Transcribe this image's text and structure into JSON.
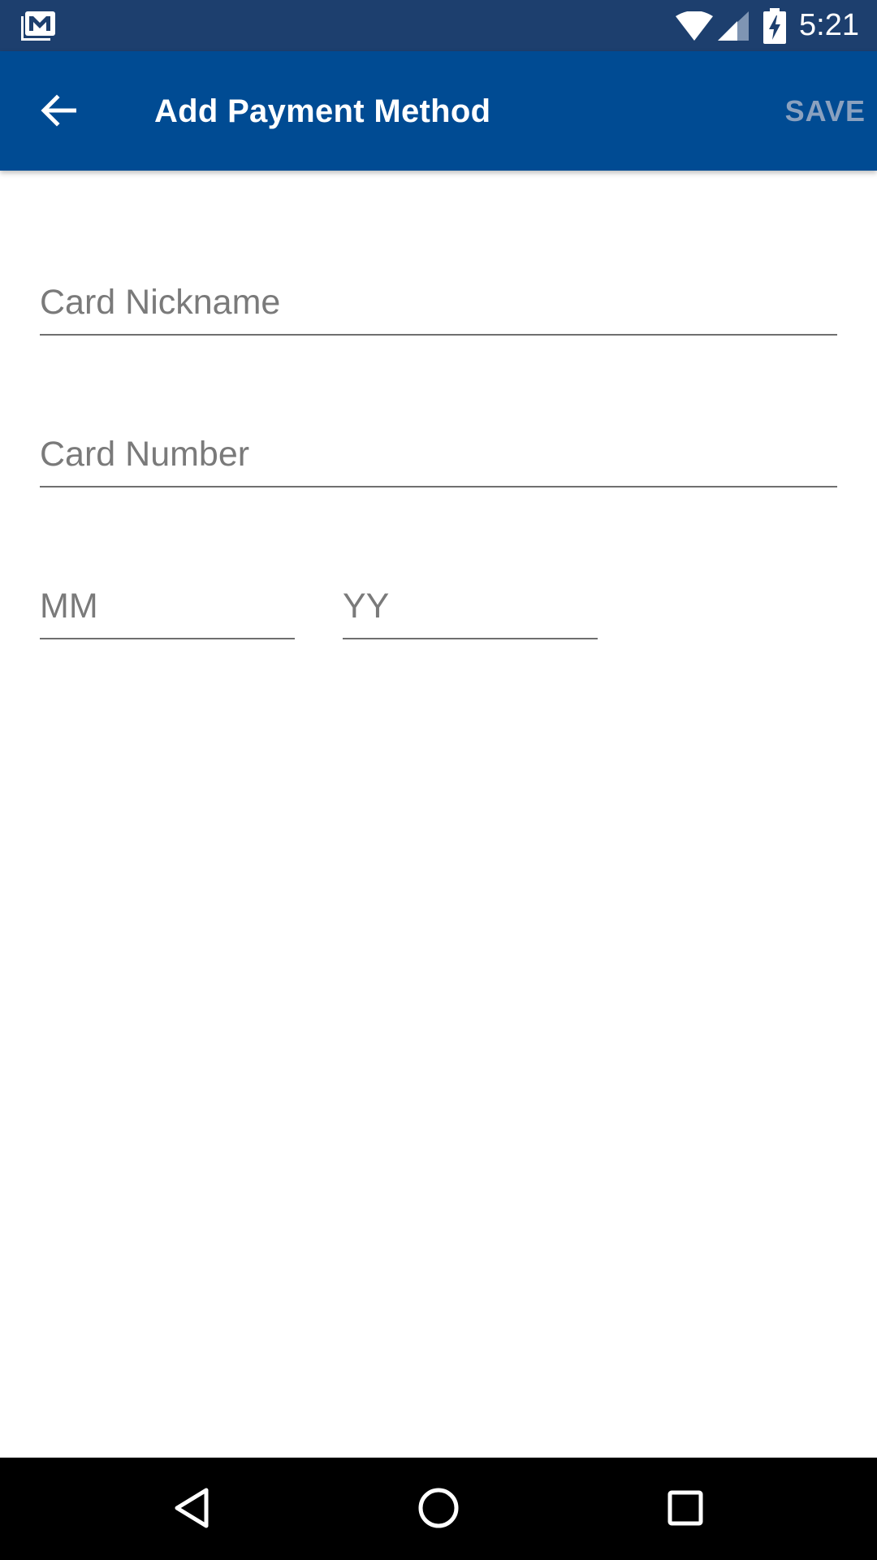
{
  "status_bar": {
    "time": "5:21",
    "icons": [
      "notification-mail-icon",
      "wifi-icon",
      "cell-signal-icon",
      "battery-charging-icon"
    ]
  },
  "app_bar": {
    "title": "Add Payment Method",
    "save_label": "SAVE",
    "back_icon": "arrow-back-icon",
    "background_color": "#004b93",
    "save_color": "#8aa1bf"
  },
  "form": {
    "card_nickname": {
      "value": "",
      "placeholder": "Card Nickname"
    },
    "card_number": {
      "value": "",
      "placeholder": "Card Number"
    },
    "expiry_month": {
      "value": "",
      "placeholder": "MM"
    },
    "expiry_year": {
      "value": "",
      "placeholder": "YY"
    }
  },
  "nav_bar": {
    "buttons": [
      "back-triangle-icon",
      "home-circle-icon",
      "recents-square-icon"
    ]
  }
}
